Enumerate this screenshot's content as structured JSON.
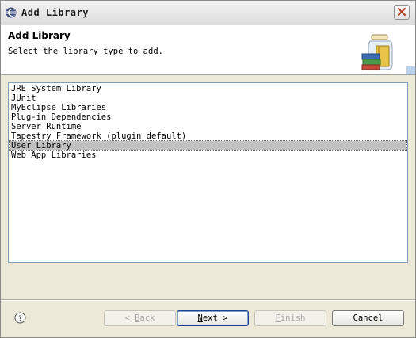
{
  "window": {
    "title": "Add Library"
  },
  "header": {
    "title": "Add Library",
    "description": "Select the library type to add."
  },
  "library_types": {
    "items": [
      "JRE System Library",
      "JUnit",
      "MyEclipse Libraries",
      "Plug-in Dependencies",
      "Server Runtime",
      "Tapestry Framework (plugin default)",
      "User Library",
      "Web App Libraries"
    ],
    "selected": "User Library"
  },
  "buttons": {
    "back": {
      "prefix": "< ",
      "mnemonic": "B",
      "rest": "ack",
      "enabled": false
    },
    "next": {
      "mnemonic": "N",
      "rest": "ext >",
      "enabled": true
    },
    "finish": {
      "mnemonic": "F",
      "rest": "inish",
      "enabled": false
    },
    "cancel": {
      "label": "Cancel",
      "enabled": true
    }
  },
  "icons": {
    "app": "eclipse-icon",
    "close": "close-icon",
    "banner": "library-jar-icon",
    "help": "help-icon"
  },
  "colors": {
    "selection": "#c0c0c0",
    "dialog_bg": "#ece9d8",
    "close_x": "#b03a1e",
    "default_button_border": "#1c3f94"
  }
}
